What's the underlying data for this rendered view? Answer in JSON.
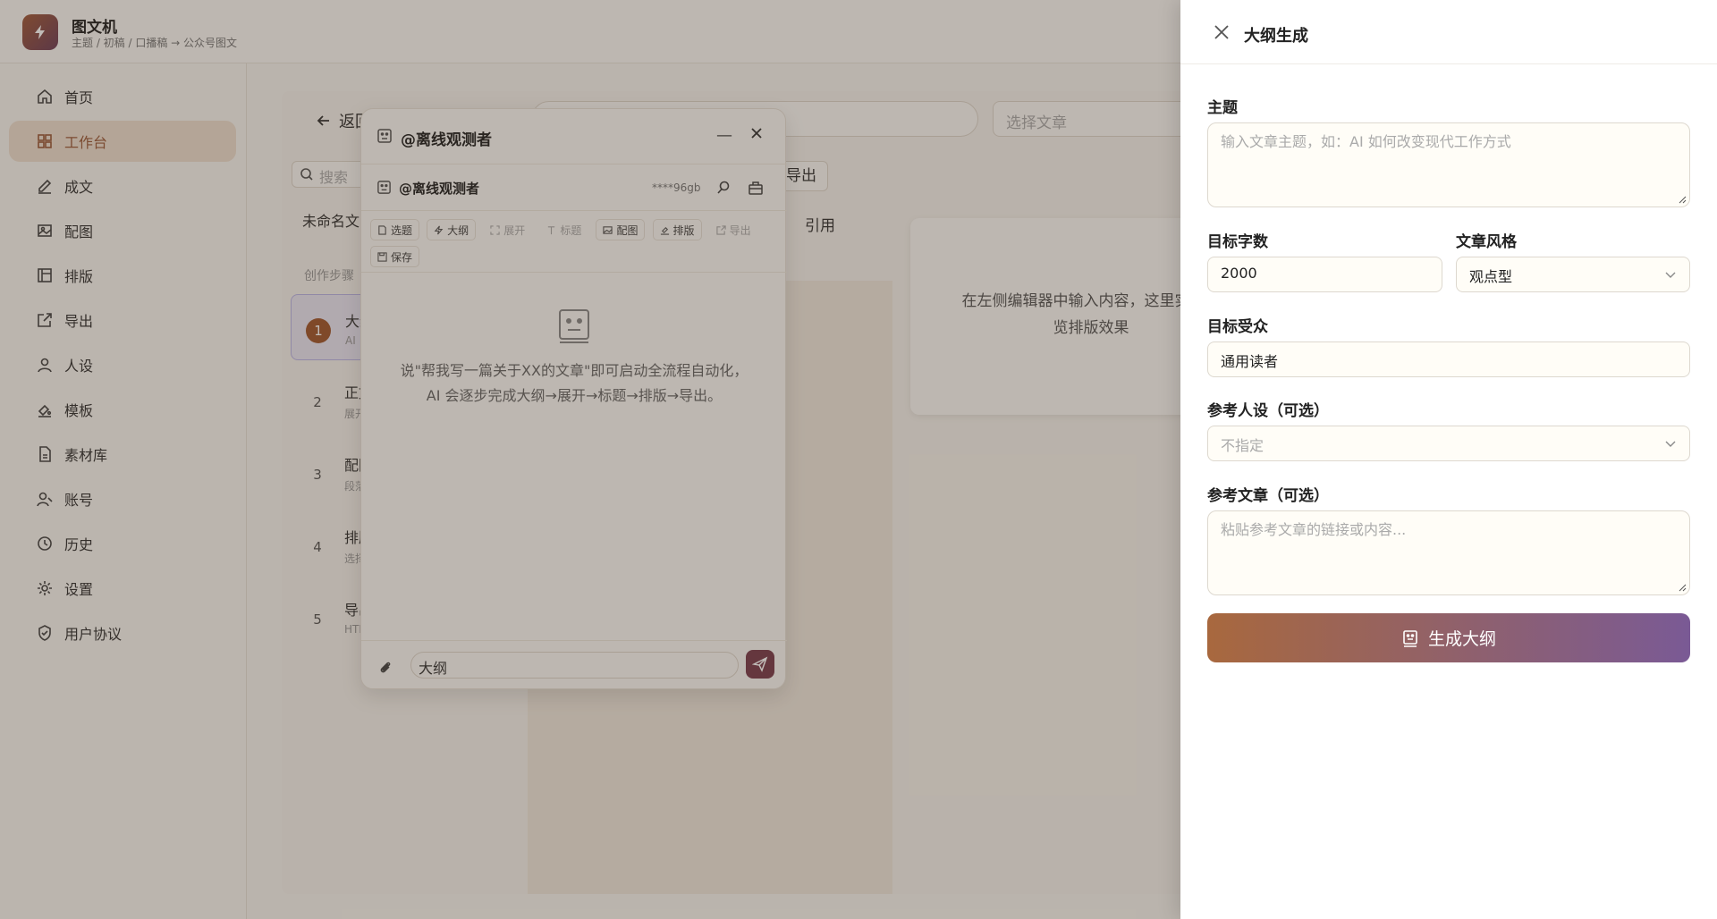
{
  "app": {
    "title": "图文机",
    "subtitle": "主题 / 初稿 / 口播稿 → 公众号图文"
  },
  "sidebar": {
    "items": [
      {
        "label": "首页",
        "icon": "home-icon"
      },
      {
        "label": "工作台",
        "icon": "grid-icon",
        "active": true
      },
      {
        "label": "成文",
        "icon": "pen-icon"
      },
      {
        "label": "配图",
        "icon": "image-icon"
      },
      {
        "label": "排版",
        "icon": "layout-icon"
      },
      {
        "label": "导出",
        "icon": "export-icon"
      },
      {
        "label": "人设",
        "icon": "person-icon"
      },
      {
        "label": "模板",
        "icon": "template-icon"
      },
      {
        "label": "素材库",
        "icon": "file-icon"
      },
      {
        "label": "账号",
        "icon": "account-icon"
      },
      {
        "label": "历史",
        "icon": "clock-icon"
      },
      {
        "label": "设置",
        "icon": "gear-icon"
      },
      {
        "label": "用户协议",
        "icon": "shield-icon"
      }
    ]
  },
  "workspace": {
    "back_label": "返回",
    "select_article_placeholder": "选择文章",
    "search_placeholder": "搜索",
    "untitled": "未命名文",
    "steps_label": "创作步骤",
    "steps": [
      {
        "num": "1",
        "title": "大纲",
        "desc": "AI"
      },
      {
        "num": "2",
        "title": "正文",
        "desc": "展开"
      },
      {
        "num": "3",
        "title": "配图",
        "desc": "段落"
      },
      {
        "num": "4",
        "title": "排版",
        "desc": "选择"
      },
      {
        "num": "5",
        "title": "导出",
        "desc": "HTML"
      }
    ],
    "export_label": "导出",
    "quote_tab": "引用",
    "preview_hint": "在左侧编辑器中输入内容，这里实时预览排版效果"
  },
  "chat": {
    "title": "@离线观测者",
    "sub_title": "@离线观测者",
    "key_masked": "****96gb",
    "tools": [
      {
        "label": "选题",
        "enabled": true
      },
      {
        "label": "大纲",
        "enabled": true
      },
      {
        "label": "展开",
        "enabled": false
      },
      {
        "label": "标题",
        "enabled": false
      },
      {
        "label": "配图",
        "enabled": true
      },
      {
        "label": "排版",
        "enabled": true
      },
      {
        "label": "导出",
        "enabled": false
      },
      {
        "label": "保存",
        "enabled": true
      }
    ],
    "hint": "说\"帮我写一篇关于XX的文章\"即可启动全流程自动化，AI 会逐步完成大纲→展开→标题→排版→导出。",
    "input_value": "大纲"
  },
  "drawer": {
    "title": "大纲生成",
    "topic_label": "主题",
    "topic_placeholder": "输入文章主题，如：AI 如何改变现代工作方式",
    "word_count_label": "目标字数",
    "word_count_value": "2000",
    "style_label": "文章风格",
    "style_value": "观点型",
    "audience_label": "目标受众",
    "audience_value": "通用读者",
    "persona_label": "参考人设（可选）",
    "persona_value": "不指定",
    "reference_label": "参考文章（可选）",
    "reference_placeholder": "粘贴参考文章的链接或内容...",
    "generate_label": "生成大纲"
  },
  "colors": {
    "accent": "#a0582f",
    "button_gradient_start": "#a8683e",
    "button_gradient_end": "#7a5a95"
  }
}
